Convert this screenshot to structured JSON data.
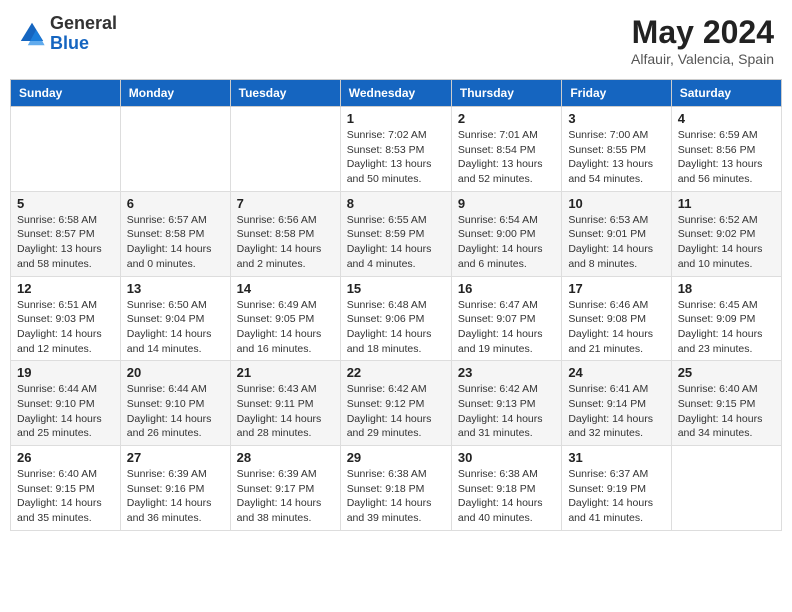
{
  "header": {
    "logo_general": "General",
    "logo_blue": "Blue",
    "month_title": "May 2024",
    "subtitle": "Alfauir, Valencia, Spain"
  },
  "weekdays": [
    "Sunday",
    "Monday",
    "Tuesday",
    "Wednesday",
    "Thursday",
    "Friday",
    "Saturday"
  ],
  "weeks": [
    [
      {
        "day": "",
        "info": ""
      },
      {
        "day": "",
        "info": ""
      },
      {
        "day": "",
        "info": ""
      },
      {
        "day": "1",
        "info": "Sunrise: 7:02 AM\nSunset: 8:53 PM\nDaylight: 13 hours\nand 50 minutes."
      },
      {
        "day": "2",
        "info": "Sunrise: 7:01 AM\nSunset: 8:54 PM\nDaylight: 13 hours\nand 52 minutes."
      },
      {
        "day": "3",
        "info": "Sunrise: 7:00 AM\nSunset: 8:55 PM\nDaylight: 13 hours\nand 54 minutes."
      },
      {
        "day": "4",
        "info": "Sunrise: 6:59 AM\nSunset: 8:56 PM\nDaylight: 13 hours\nand 56 minutes."
      }
    ],
    [
      {
        "day": "5",
        "info": "Sunrise: 6:58 AM\nSunset: 8:57 PM\nDaylight: 13 hours\nand 58 minutes."
      },
      {
        "day": "6",
        "info": "Sunrise: 6:57 AM\nSunset: 8:58 PM\nDaylight: 14 hours\nand 0 minutes."
      },
      {
        "day": "7",
        "info": "Sunrise: 6:56 AM\nSunset: 8:58 PM\nDaylight: 14 hours\nand 2 minutes."
      },
      {
        "day": "8",
        "info": "Sunrise: 6:55 AM\nSunset: 8:59 PM\nDaylight: 14 hours\nand 4 minutes."
      },
      {
        "day": "9",
        "info": "Sunrise: 6:54 AM\nSunset: 9:00 PM\nDaylight: 14 hours\nand 6 minutes."
      },
      {
        "day": "10",
        "info": "Sunrise: 6:53 AM\nSunset: 9:01 PM\nDaylight: 14 hours\nand 8 minutes."
      },
      {
        "day": "11",
        "info": "Sunrise: 6:52 AM\nSunset: 9:02 PM\nDaylight: 14 hours\nand 10 minutes."
      }
    ],
    [
      {
        "day": "12",
        "info": "Sunrise: 6:51 AM\nSunset: 9:03 PM\nDaylight: 14 hours\nand 12 minutes."
      },
      {
        "day": "13",
        "info": "Sunrise: 6:50 AM\nSunset: 9:04 PM\nDaylight: 14 hours\nand 14 minutes."
      },
      {
        "day": "14",
        "info": "Sunrise: 6:49 AM\nSunset: 9:05 PM\nDaylight: 14 hours\nand 16 minutes."
      },
      {
        "day": "15",
        "info": "Sunrise: 6:48 AM\nSunset: 9:06 PM\nDaylight: 14 hours\nand 18 minutes."
      },
      {
        "day": "16",
        "info": "Sunrise: 6:47 AM\nSunset: 9:07 PM\nDaylight: 14 hours\nand 19 minutes."
      },
      {
        "day": "17",
        "info": "Sunrise: 6:46 AM\nSunset: 9:08 PM\nDaylight: 14 hours\nand 21 minutes."
      },
      {
        "day": "18",
        "info": "Sunrise: 6:45 AM\nSunset: 9:09 PM\nDaylight: 14 hours\nand 23 minutes."
      }
    ],
    [
      {
        "day": "19",
        "info": "Sunrise: 6:44 AM\nSunset: 9:10 PM\nDaylight: 14 hours\nand 25 minutes."
      },
      {
        "day": "20",
        "info": "Sunrise: 6:44 AM\nSunset: 9:10 PM\nDaylight: 14 hours\nand 26 minutes."
      },
      {
        "day": "21",
        "info": "Sunrise: 6:43 AM\nSunset: 9:11 PM\nDaylight: 14 hours\nand 28 minutes."
      },
      {
        "day": "22",
        "info": "Sunrise: 6:42 AM\nSunset: 9:12 PM\nDaylight: 14 hours\nand 29 minutes."
      },
      {
        "day": "23",
        "info": "Sunrise: 6:42 AM\nSunset: 9:13 PM\nDaylight: 14 hours\nand 31 minutes."
      },
      {
        "day": "24",
        "info": "Sunrise: 6:41 AM\nSunset: 9:14 PM\nDaylight: 14 hours\nand 32 minutes."
      },
      {
        "day": "25",
        "info": "Sunrise: 6:40 AM\nSunset: 9:15 PM\nDaylight: 14 hours\nand 34 minutes."
      }
    ],
    [
      {
        "day": "26",
        "info": "Sunrise: 6:40 AM\nSunset: 9:15 PM\nDaylight: 14 hours\nand 35 minutes."
      },
      {
        "day": "27",
        "info": "Sunrise: 6:39 AM\nSunset: 9:16 PM\nDaylight: 14 hours\nand 36 minutes."
      },
      {
        "day": "28",
        "info": "Sunrise: 6:39 AM\nSunset: 9:17 PM\nDaylight: 14 hours\nand 38 minutes."
      },
      {
        "day": "29",
        "info": "Sunrise: 6:38 AM\nSunset: 9:18 PM\nDaylight: 14 hours\nand 39 minutes."
      },
      {
        "day": "30",
        "info": "Sunrise: 6:38 AM\nSunset: 9:18 PM\nDaylight: 14 hours\nand 40 minutes."
      },
      {
        "day": "31",
        "info": "Sunrise: 6:37 AM\nSunset: 9:19 PM\nDaylight: 14 hours\nand 41 minutes."
      },
      {
        "day": "",
        "info": ""
      }
    ]
  ]
}
